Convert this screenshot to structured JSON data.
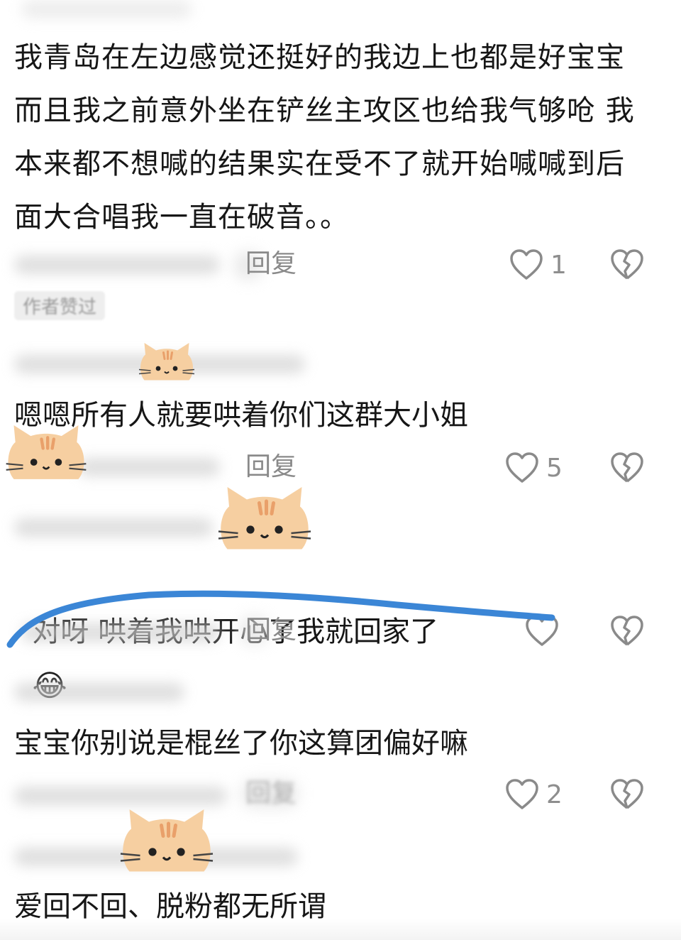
{
  "comments": [
    {
      "text": "我青岛在左边感觉还挺好的我边上也都是好宝宝 而且我之前意外坐在铲丝主攻区也给我气够呛 我本来都不想喊的结果实在受不了就开始喊喊到后面大合唱我一直在破音。。",
      "reply": "回复",
      "likes": "1",
      "badge": "作者赞过"
    },
    {
      "text": "嗯嗯所有人就要哄着你们这群大小姐",
      "reply": "回复",
      "likes": "5"
    },
    {
      "text": "对呀 哄着我哄开心了我就回家了",
      "emoji": "😂",
      "reply": "回复",
      "likes": ""
    },
    {
      "text": "宝宝你别说是棍丝了你这算团偏好嘛",
      "reply": "回复",
      "likes": "2"
    },
    {
      "text": "爱回不回、脱粉都无所谓"
    }
  ],
  "colors": {
    "annotation_stroke": "#3b86d6",
    "cat_fur": "#f6cfa1",
    "cat_stripe": "#e9a06a",
    "icon_stroke": "#8a8a8a"
  },
  "icons": {
    "like": "heart-outline-icon",
    "dislike": "broken-heart-icon",
    "sticker": "cat-face-sticker"
  }
}
